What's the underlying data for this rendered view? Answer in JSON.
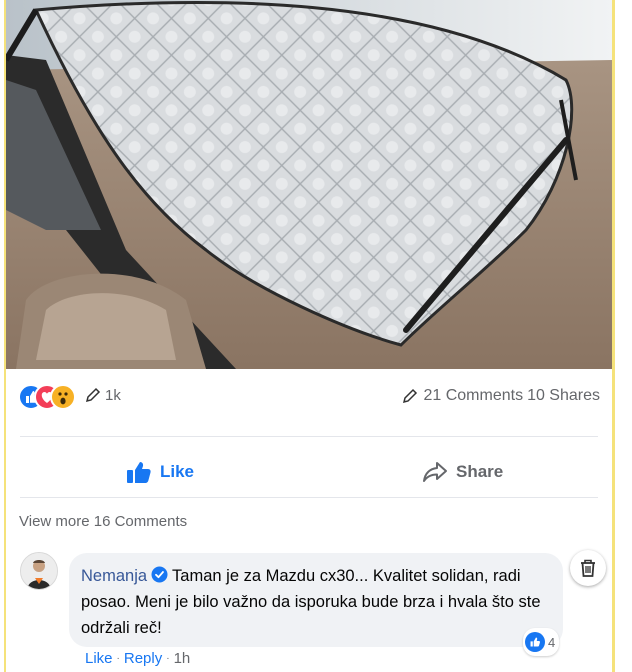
{
  "post": {
    "image_alt": "Car windshield covered with a quilted silver sun shade",
    "reaction_count": "1k",
    "comments_label": "21 Comments",
    "shares_label": "10 Shares",
    "like_label": "Like",
    "share_label": "Share",
    "view_more": "View more 16 Comments"
  },
  "comment": {
    "author": "Nemanja",
    "text": "Taman je za Mazdu cx30... Kvalitet solidan, radi posao. Meni je bilo važno da isporuka bude brza i hvala što ste održali reč!",
    "reaction_count": "4",
    "like": "Like",
    "reply": "Reply",
    "time": "1h"
  },
  "colors": {
    "facebook_blue": "#1877f2",
    "muted_text": "#65676b",
    "bubble_bg": "#f0f2f5",
    "accent_edge": "#f5e27a"
  },
  "icons": [
    "like-reaction-icon",
    "love-reaction-icon",
    "wow-reaction-icon",
    "pencil-icon",
    "thumbs-up-icon",
    "share-arrow-icon",
    "verified-badge-icon",
    "trash-icon"
  ]
}
